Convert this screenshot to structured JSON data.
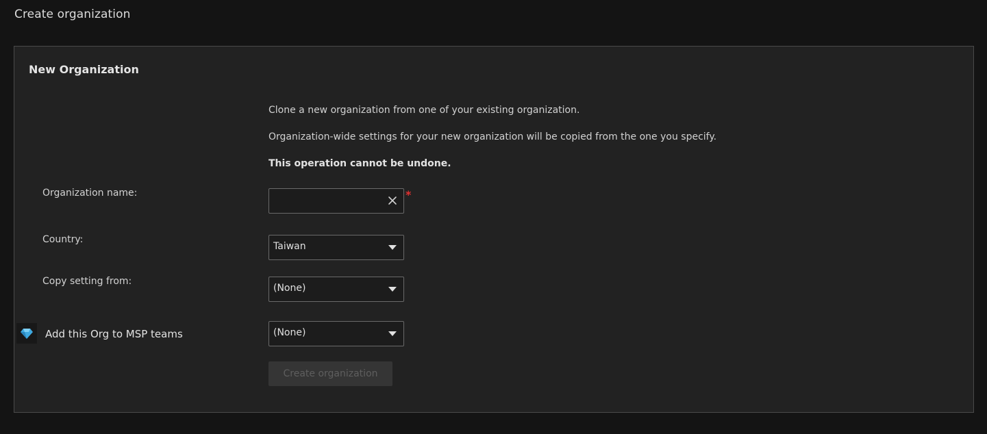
{
  "page": {
    "title": "Create organization"
  },
  "panel": {
    "title": "New Organization",
    "info": {
      "line1": "Clone a new organization from one of your existing organization.",
      "line2": "Organization-wide settings for your new organization will be copied from the one you specify.",
      "warning": "This operation cannot be undone."
    }
  },
  "form": {
    "org_name": {
      "label": "Organization name:",
      "value": "",
      "placeholder": "",
      "required_mark": "*"
    },
    "country": {
      "label": "Country:",
      "selected": "Taiwan"
    },
    "copy_setting": {
      "label": "Copy setting from:",
      "selected": "(None)"
    },
    "msp_teams": {
      "label": "Add this Org to MSP teams",
      "icon": "diamond-icon",
      "selected": "(None)"
    },
    "submit_label": "Create organization"
  },
  "colors": {
    "background": "#141414",
    "panel": "#222222",
    "required": "#e03030",
    "diamond": "#3fa9e0",
    "button_disabled_bg": "#353535",
    "button_disabled_text": "#5e5e5e"
  }
}
